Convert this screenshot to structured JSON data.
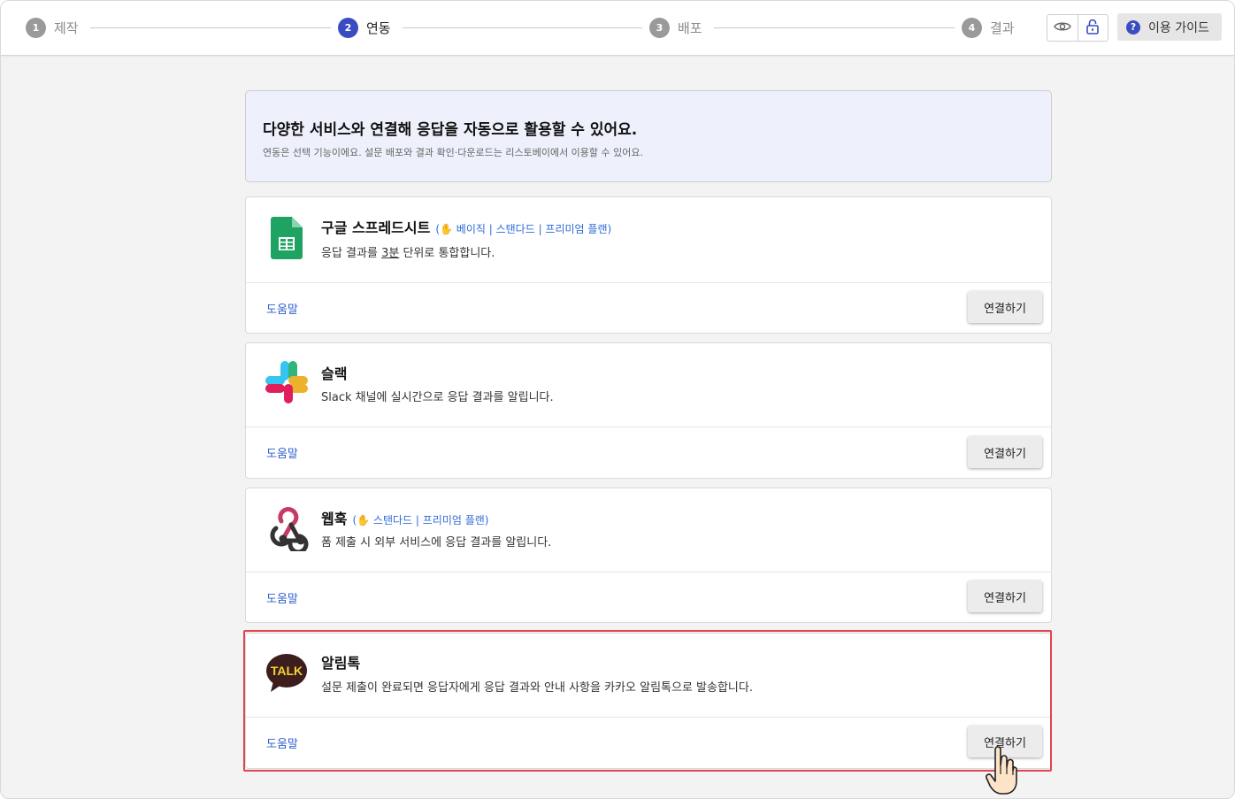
{
  "steps": [
    {
      "num": "1",
      "label": "제작",
      "active": false
    },
    {
      "num": "2",
      "label": "연동",
      "active": true
    },
    {
      "num": "3",
      "label": "배포",
      "active": false
    },
    {
      "num": "4",
      "label": "결과",
      "active": false
    }
  ],
  "toolbar": {
    "preview_icon": "eye-icon",
    "lock_icon": "lock-icon",
    "guide_icon_text": "?",
    "guide_label": "이용 가이드"
  },
  "banner": {
    "title": "다양한 서비스와 연결해 응답을 자동으로 활용할 수 있어요.",
    "subtitle": "연동은 선택 기능이에요. 설문 배포와 결과 확인·다운로드는 리스토베이에서 이용할 수 있어요."
  },
  "integrations": [
    {
      "name": "구글 스프레드시트",
      "plan": "( 베이직 | 스탠다드 | 프리미엄 플랜)",
      "desc_pre": "응답 결과를 ",
      "desc_em": "3분",
      "desc_post": " 단위로 통합합니다.",
      "help": "도움말",
      "connect": "연결하기"
    },
    {
      "name": "슬랙",
      "plan": "",
      "desc_pre": "Slack 채널에 실시간으로 응답 결과를 알립니다.",
      "desc_em": "",
      "desc_post": "",
      "help": "도움말",
      "connect": "연결하기"
    },
    {
      "name": "웹훅",
      "plan": "( 스탠다드 | 프리미엄 플랜)",
      "desc_pre": "폼 제출 시 외부 서비스에 응답 결과를 알립니다.",
      "desc_em": "",
      "desc_post": "",
      "help": "도움말",
      "connect": "연결하기"
    },
    {
      "name": "알림톡",
      "plan": "",
      "desc_pre": "설문 제출이 완료되면 응답자에게 응답 결과와 안내 사항을 카카오 알림톡으로 발송합니다.",
      "desc_em": "",
      "desc_post": "",
      "help": "도움말",
      "connect": "연결하기",
      "logo_text": "TALK"
    }
  ],
  "colors": {
    "accent": "#3b4cc0",
    "link": "#2f5fcf",
    "highlight": "#e0444c",
    "sheets_green": "#1ea362",
    "kakao_yellow": "#f5d230"
  }
}
